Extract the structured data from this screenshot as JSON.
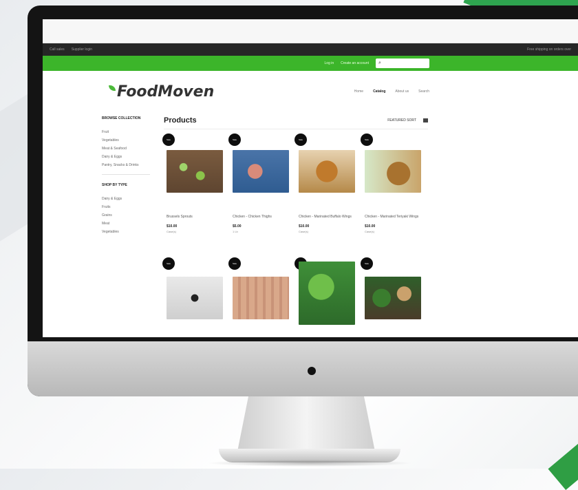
{
  "site": {
    "logo_text": "FoodMoven",
    "nav": [
      {
        "label": "Home"
      },
      {
        "label": "Catalog",
        "active": true
      },
      {
        "label": "About us"
      },
      {
        "label": "Search"
      }
    ]
  },
  "topbar": {
    "left_items": [
      "Call sales",
      "Supplier login"
    ],
    "right_text": "Free shipping on orders over"
  },
  "greenbar": {
    "links": [
      "Log in",
      "Create an account"
    ],
    "search_icon": "search-icon"
  },
  "sidebar": {
    "browse_heading": "BROWSE COLLECTION",
    "browse_items": [
      "Fruit",
      "Vegetables",
      "Meat & Seafood",
      "Dairy & Eggs",
      "Pantry, Snacks & Drinks"
    ],
    "type_heading": "SHOP BY TYPE",
    "type_items": [
      "Dairy & Eggs",
      "Fruits",
      "Grains",
      "Meat",
      "Vegetables"
    ]
  },
  "main": {
    "title": "Products",
    "sort_label": "FEATURED SORT",
    "grid_icon": "grid-view-icon"
  },
  "products": [
    {
      "badge": "Sale",
      "name": "Brussels Sprouts",
      "price": "$10.00",
      "unit": "Case(s)",
      "image": "sprouts"
    },
    {
      "badge": "Sale",
      "name": "Chicken - Chicken Thighs",
      "price": "$5.00",
      "unit": "1 Lb",
      "image": "wings"
    },
    {
      "badge": "Sale",
      "name": "Chicken - Marinated Buffalo Wings",
      "price": "$10.00",
      "unit": "Case(s)",
      "image": "buffalo"
    },
    {
      "badge": "Sale",
      "name": "Chicken - Marinated Teriyaki Wings",
      "price": "$10.00",
      "unit": "Case(s)",
      "image": "teriyaki"
    },
    {
      "badge": "Sale",
      "name": "",
      "price": "",
      "unit": "",
      "image": "bag"
    },
    {
      "badge": "Sale",
      "name": "",
      "price": "",
      "unit": "",
      "image": "box"
    },
    {
      "badge": "Sale",
      "name": "",
      "price": "",
      "unit": "",
      "image": "greens"
    },
    {
      "badge": "Sale",
      "name": "",
      "price": "",
      "unit": "",
      "image": "mixed"
    }
  ],
  "colors": {
    "brand_green": "#3cb52a",
    "topbar_dark": "#262626"
  }
}
